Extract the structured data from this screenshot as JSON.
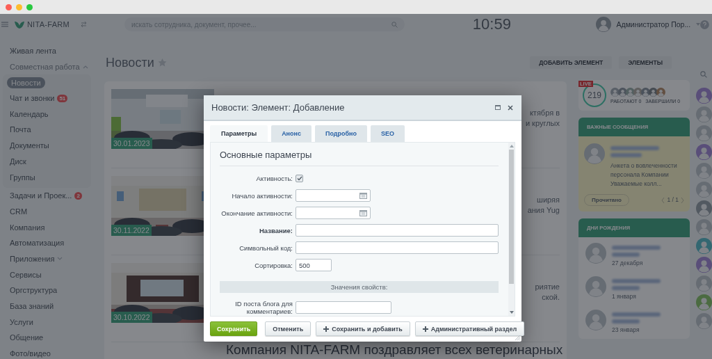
{
  "header": {
    "logo": "NITA-FARM",
    "search": {
      "placeholder": "искать сотрудника, документ, прочее..."
    },
    "clock": "10:59",
    "user": "Администратор Пор..."
  },
  "sidebar": {
    "items": [
      {
        "label": "Живая лента",
        "selected": false
      },
      {
        "label": "Совместная работа",
        "selected": false,
        "expanded": true,
        "children": [
          {
            "label": "Новости",
            "selected": true
          },
          {
            "label": "Чат и звонки",
            "counter": "51",
            "selected": false
          },
          {
            "label": "Календарь",
            "selected": false
          },
          {
            "label": "Почта",
            "selected": false
          },
          {
            "label": "Документы",
            "selected": false
          },
          {
            "label": "Диск",
            "selected": false
          },
          {
            "label": "Группы",
            "selected": false
          }
        ]
      },
      {
        "label": "Задачи и Проек...",
        "counter": "2",
        "selected": false
      },
      {
        "label": "CRM",
        "selected": false
      },
      {
        "label": "Компания",
        "selected": false
      },
      {
        "label": "Автоматизация",
        "selected": false
      },
      {
        "label": "Приложения",
        "selected": false,
        "expanded": false
      },
      {
        "label": "Сервисы",
        "selected": false
      },
      {
        "label": "Оргструктура",
        "selected": false
      },
      {
        "label": "База знаний",
        "selected": false
      },
      {
        "label": "Услуги",
        "selected": false
      },
      {
        "label": "Общение",
        "selected": false
      },
      {
        "label": "Фото/видео",
        "selected": false
      }
    ]
  },
  "page": {
    "title": "Новости",
    "starred": false,
    "actions": [
      "ДОБАВИТЬ ЭЛЕМЕНТ",
      "ЭЛЕМЕНТЫ"
    ]
  },
  "news": [
    {
      "date": "30.01.2023",
      "excerpt": [
        "ктября в",
        "и круглых"
      ]
    },
    {
      "date": "30.11.2022",
      "excerpt": [
        "ширяя",
        "ания Yug"
      ]
    },
    {
      "date": "30.10.2022",
      "excerpt": [
        "риятие",
        "ской."
      ]
    },
    {
      "kind": "headline",
      "title": "Компания NITA-FARM поздравляет всех ветеринарных"
    }
  ],
  "live": {
    "badge": "LIVE",
    "count": "219",
    "working": "РАБОТАЮТ 0",
    "finished": "ЗАВЕРШИЛИ 0"
  },
  "important_messages": {
    "title": "ВАЖНЫЕ СООБЩЕНИЯ",
    "message": "Анкета о вовлеченности персонала Компании Уважаемые колл...",
    "read_button": "Прочитано",
    "pager": "1 / 1"
  },
  "birthdays": {
    "title": "ДНИ РОЖДЕНИЯ",
    "people": [
      {
        "date": "27 декабря"
      },
      {
        "date": "1 января"
      },
      {
        "date": "23 января"
      }
    ]
  },
  "dialog": {
    "title": "Новости: Элемент: Добавление",
    "tabs": [
      {
        "label": "Параметры",
        "selected": true
      },
      {
        "label": "Анонс",
        "selected": false
      },
      {
        "label": "Подробно",
        "selected": false
      },
      {
        "label": "SEO",
        "selected": false
      }
    ],
    "section_title": "Основные параметры",
    "fields": [
      {
        "kind": "checkbox",
        "label": "Активность:",
        "checked": true,
        "required": false
      },
      {
        "kind": "date",
        "label": "Начало активности:",
        "required": false
      },
      {
        "kind": "date",
        "label": "Окончание активности:",
        "required": false
      },
      {
        "kind": "text",
        "label": "Название:",
        "required": true
      },
      {
        "kind": "text",
        "label": "Символьный код:",
        "required": false
      },
      {
        "kind": "short",
        "label": "Сортировка:",
        "value": "500",
        "required": false
      },
      {
        "kind": "section",
        "label": "Значения свойств:"
      },
      {
        "kind": "medium",
        "label": "ID поста блога для комментариев:",
        "required": false
      }
    ],
    "buttons": [
      {
        "kind": "primary",
        "label": "Сохранить"
      },
      {
        "kind": "plain",
        "label": "Отменить"
      },
      {
        "kind": "add",
        "label": "Сохранить и добавить"
      },
      {
        "kind": "add",
        "label": "Административный раздел"
      }
    ]
  }
}
